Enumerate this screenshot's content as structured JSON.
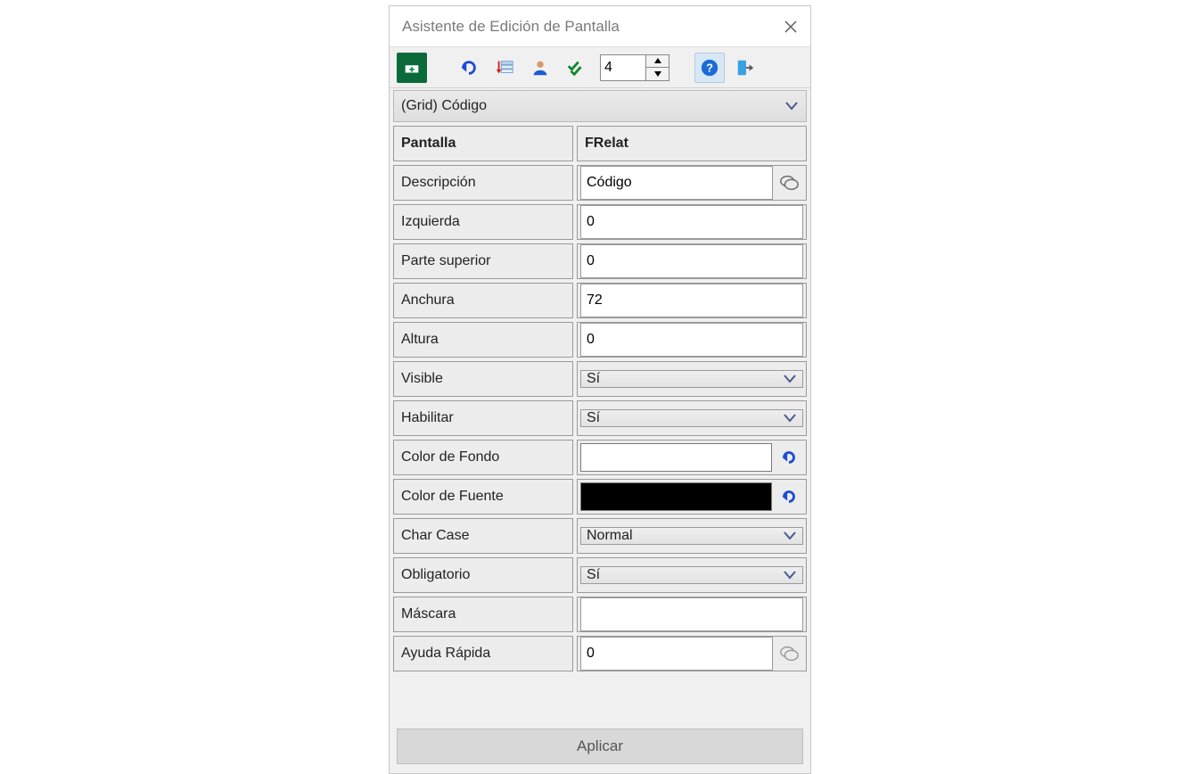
{
  "window": {
    "title": "Asistente de Edición de Pantalla"
  },
  "toolbar": {
    "spinner_value": "4"
  },
  "combo": {
    "selected": "(Grid) Código"
  },
  "rows": {
    "pantalla_label": "Pantalla",
    "pantalla_value": "FRelat",
    "descripcion_label": "Descripción",
    "descripcion_value": "Código",
    "izquierda_label": "Izquierda",
    "izquierda_value": "0",
    "parte_superior_label": "Parte superior",
    "parte_superior_value": "0",
    "anchura_label": "Anchura",
    "anchura_value": "72",
    "altura_label": "Altura",
    "altura_value": "0",
    "visible_label": "Visible",
    "visible_value": "Sí",
    "habilitar_label": "Habilitar",
    "habilitar_value": "Sí",
    "color_fondo_label": "Color de Fondo",
    "color_fondo_value": "#FFFFFF",
    "color_fuente_label": "Color de Fuente",
    "color_fuente_value": "#000000",
    "charcase_label": "Char Case",
    "charcase_value": "Normal",
    "obligatorio_label": "Obligatorio",
    "obligatorio_value": "Sí",
    "mascara_label": "Máscara",
    "mascara_value": "",
    "ayuda_label": "Ayuda Rápida",
    "ayuda_value": "0"
  },
  "footer": {
    "apply_label": "Aplicar"
  }
}
